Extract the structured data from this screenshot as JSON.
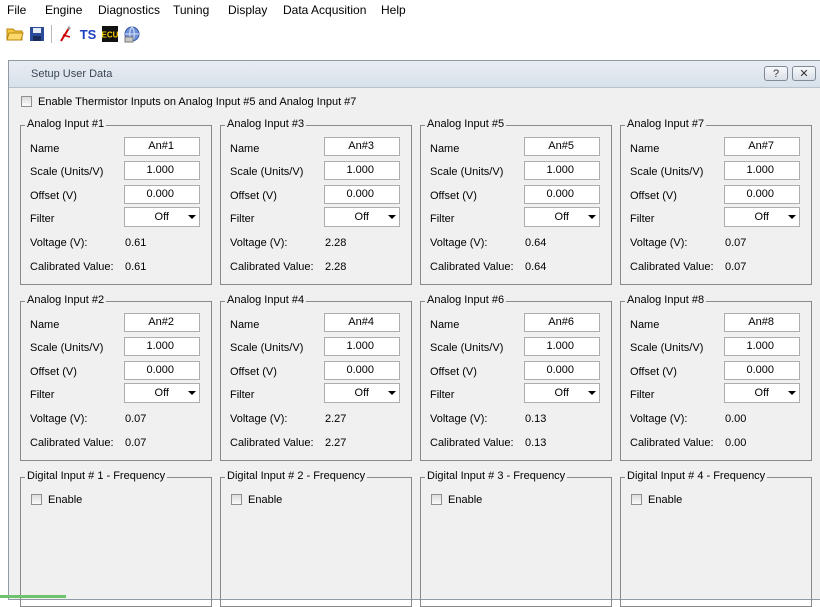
{
  "menu": [
    "File",
    "Engine",
    "Diagnostics",
    "Tuning",
    "Display",
    "Data Acqusition",
    "Help"
  ],
  "toolbar": {
    "icons": [
      "open-folder-icon",
      "save-disk-icon",
      "tuning-pen-icon",
      "ts-logo-icon",
      "ecu-icon",
      "network-globe-icon"
    ],
    "ts_label": "TS",
    "ecu_label": "ECU"
  },
  "dialog": {
    "title": "Setup User Data",
    "help_btn": "?",
    "close_btn": "✕",
    "thermistor_label": "Enable Thermistor Inputs on Analog Input #5 and Analog Input #7",
    "labels": {
      "name": "Name",
      "scale": "Scale (Units/V)",
      "offset": "Offset (V)",
      "filter": "Filter",
      "voltage": "Voltage (V):",
      "calibrated": "Calibrated Value:",
      "enable": "Enable"
    },
    "analog": [
      {
        "title": "Analog Input #1",
        "name": "An#1",
        "scale": "1.000",
        "offset": "0.000",
        "filter": "Off",
        "voltage": "0.61",
        "calibrated": "0.61"
      },
      {
        "title": "Analog Input #3",
        "name": "An#3",
        "scale": "1.000",
        "offset": "0.000",
        "filter": "Off",
        "voltage": "2.28",
        "calibrated": "2.28"
      },
      {
        "title": "Analog Input #5",
        "name": "An#5",
        "scale": "1.000",
        "offset": "0.000",
        "filter": "Off",
        "voltage": "0.64",
        "calibrated": "0.64"
      },
      {
        "title": "Analog Input #7",
        "name": "An#7",
        "scale": "1.000",
        "offset": "0.000",
        "filter": "Off",
        "voltage": "0.07",
        "calibrated": "0.07"
      },
      {
        "title": "Analog Input #2",
        "name": "An#2",
        "scale": "1.000",
        "offset": "0.000",
        "filter": "Off",
        "voltage": "0.07",
        "calibrated": "0.07"
      },
      {
        "title": "Analog Input #4",
        "name": "An#4",
        "scale": "1.000",
        "offset": "0.000",
        "filter": "Off",
        "voltage": "2.27",
        "calibrated": "2.27"
      },
      {
        "title": "Analog Input #6",
        "name": "An#6",
        "scale": "1.000",
        "offset": "0.000",
        "filter": "Off",
        "voltage": "0.13",
        "calibrated": "0.13"
      },
      {
        "title": "Analog Input #8",
        "name": "An#8",
        "scale": "1.000",
        "offset": "0.000",
        "filter": "Off",
        "voltage": "0.00",
        "calibrated": "0.00"
      }
    ],
    "digital": [
      {
        "title": "Digital Input # 1 - Frequency"
      },
      {
        "title": "Digital Input # 2 - Frequency"
      },
      {
        "title": "Digital Input # 3 - Frequency"
      },
      {
        "title": "Digital Input # 4 - Frequency"
      }
    ]
  }
}
